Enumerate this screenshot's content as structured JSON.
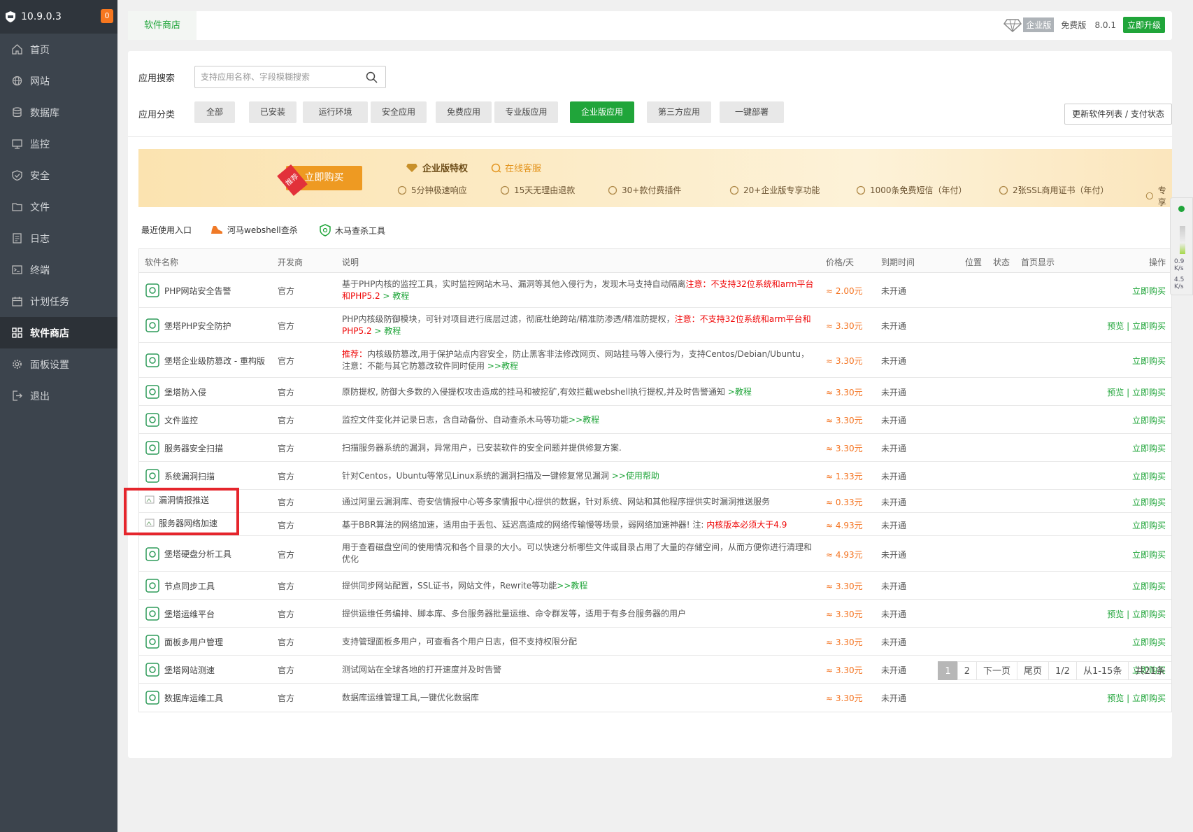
{
  "sidebar": {
    "ip": "10.9.0.3",
    "badge": "0",
    "items": [
      {
        "label": "首页",
        "icon": "home-icon"
      },
      {
        "label": "网站",
        "icon": "globe-icon"
      },
      {
        "label": "数据库",
        "icon": "database-icon"
      },
      {
        "label": "监控",
        "icon": "monitor-icon"
      },
      {
        "label": "安全",
        "icon": "shield-icon"
      },
      {
        "label": "文件",
        "icon": "folder-icon"
      },
      {
        "label": "日志",
        "icon": "log-icon"
      },
      {
        "label": "终端",
        "icon": "terminal-icon"
      },
      {
        "label": "计划任务",
        "icon": "calendar-icon"
      },
      {
        "label": "软件商店",
        "icon": "grid-icon"
      },
      {
        "label": "面板设置",
        "icon": "gear-icon"
      },
      {
        "label": "退出",
        "icon": "logout-icon"
      }
    ],
    "active_index": 9
  },
  "topbar": {
    "tab": "软件商店",
    "edition": "企业版",
    "free": "免费版",
    "version": "8.0.1",
    "upgrade": "立即升级"
  },
  "search": {
    "label": "应用搜索",
    "placeholder": "支持应用名称、字段模糊搜索"
  },
  "category": {
    "label": "应用分类",
    "items": [
      "全部",
      "已安装",
      "运行环境",
      "安全应用",
      "免费应用",
      "专业版应用",
      "企业版应用",
      "第三方应用",
      "一键部署"
    ],
    "active_index": 6,
    "refresh": "更新软件列表 / 支付状态"
  },
  "banner": {
    "badge": "推荐",
    "buy": "立即购买",
    "title": "企业版特权",
    "service": "在线客服",
    "features": [
      "5分钟极速响应",
      "15天无理由退款",
      "30+款付费插件",
      "20+企业版专享功能",
      "1000条免费短信（年付）",
      "2张SSL商用证书（年付）",
      "专享"
    ]
  },
  "recent": {
    "label": "最近使用入口",
    "items": [
      "河马webshell查杀",
      "木马查杀工具"
    ]
  },
  "table": {
    "headers": {
      "name": "软件名称",
      "dev": "开发商",
      "desc": "说明",
      "price": "价格/天",
      "expire": "到期时间",
      "pos": "位置",
      "status": "状态",
      "home": "首页显示",
      "op": "操作"
    },
    "rows": [
      {
        "name": "PHP网站安全告警",
        "dev": "官方",
        "desc": "基于PHP内核的监控工具，实时监控网站木马、漏洞等其他入侵行为，发现木马支持自动隔离",
        "desc_red": "注意：不支持32位系统和arm平台和PHP5.2",
        "desc_link": " > 教程",
        "price": "≈ 2.00元",
        "expire": "未开通",
        "preview": "",
        "buy": "立即购买"
      },
      {
        "name": "堡塔PHP安全防护",
        "dev": "官方",
        "desc": "PHP内核级防御模块，可针对项目进行底层过滤，彻底杜绝跨站/精准防渗透/精准防提权，",
        "desc_red": "注意：不支持32位系统和arm平台和PHP5.2",
        "desc_link": " > 教程",
        "price": "≈ 3.30元",
        "expire": "未开通",
        "preview": "预览 | ",
        "buy": "立即购买"
      },
      {
        "name": "堡塔企业级防篡改 - 重构版",
        "dev": "官方",
        "desc_red": "推荐：",
        "desc": "内核级防篡改,用于保护站点内容安全，防止黑客非法修改网页、网站挂马等入侵行为，支持Centos/Debian/Ubuntu，注意：不能与其它防篡改软件同时使用",
        "desc_link": " >>教程",
        "price": "≈ 3.30元",
        "expire": "未开通",
        "preview": "",
        "buy": "立即购买"
      },
      {
        "name": "堡塔防入侵",
        "dev": "官方",
        "desc": "原防提权, 防御大多数的入侵提权攻击造成的挂马和被挖矿,有效拦截webshell执行提权,并及时告警通知",
        "desc_red": "",
        "desc_link": " >教程",
        "price": "≈ 3.30元",
        "expire": "未开通",
        "preview": "预览 | ",
        "buy": "立即购买"
      },
      {
        "name": "文件监控",
        "dev": "官方",
        "desc": "监控文件变化并记录日志，含自动备份、自动查杀木马等功能",
        "desc_red": "",
        "desc_link": ">>教程",
        "price": "≈ 3.30元",
        "expire": "未开通",
        "preview": "",
        "buy": "立即购买"
      },
      {
        "name": "服务器安全扫描",
        "dev": "官方",
        "desc": "扫描服务器系统的漏洞，异常用户，已安装软件的安全问题并提供修复方案.",
        "desc_red": "",
        "desc_link": "",
        "price": "≈ 3.30元",
        "expire": "未开通",
        "preview": "",
        "buy": "立即购买"
      },
      {
        "name": "系统漏洞扫描",
        "dev": "官方",
        "desc": "针对Centos，Ubuntu等常见Linux系统的漏洞扫描及一键修复常见漏洞 ",
        "desc_red": "",
        "desc_link": ">>使用帮助",
        "price": "≈ 1.33元",
        "expire": "未开通",
        "preview": "",
        "buy": "立即购买"
      },
      {
        "name": "漏洞情报推送",
        "dev": "官方",
        "desc": "通过阿里云漏洞库、奇安信情报中心等多家情报中心提供的数据，针对系统、网站和其他程序提供实时漏洞推送服务",
        "desc_red": "",
        "desc_link": "",
        "price": "≈ 0.33元",
        "expire": "未开通",
        "preview": "",
        "buy": "立即购买"
      },
      {
        "name": "服务器网络加速",
        "dev": "官方",
        "desc": "基于BBR算法的网络加速，适用由于丢包、延迟高造成的网络传输慢等场景，弱网络加速神器! 注: ",
        "desc_red": "内核版本必须大于4.9",
        "desc_link": "",
        "price": "≈ 4.93元",
        "expire": "未开通",
        "preview": "",
        "buy": "立即购买"
      },
      {
        "name": "堡塔硬盘分析工具",
        "dev": "官方",
        "desc": "用于查看磁盘空间的使用情况和各个目录的大小。可以快速分析哪些文件或目录占用了大量的存储空间，从而方便你进行清理和优化",
        "desc_red": "",
        "desc_link": "",
        "price": "≈ 4.93元",
        "expire": "未开通",
        "preview": "",
        "buy": "立即购买"
      },
      {
        "name": "节点同步工具",
        "dev": "官方",
        "desc": "提供同步网站配置，SSL证书，网站文件，Rewrite等功能",
        "desc_red": "",
        "desc_link": ">>教程",
        "price": "≈ 3.30元",
        "expire": "未开通",
        "preview": "",
        "buy": "立即购买"
      },
      {
        "name": "堡塔运维平台",
        "dev": "官方",
        "desc": "提供运维任务编排、脚本库、多台服务器批量运维、命令群发等，适用于有多台服务器的用户",
        "desc_red": "",
        "desc_link": "",
        "price": "≈ 3.30元",
        "expire": "未开通",
        "preview": "预览 | ",
        "buy": "立即购买"
      },
      {
        "name": "面板多用户管理",
        "dev": "官方",
        "desc": "支持管理面板多用户，可查看各个用户日志，但不支持权限分配",
        "desc_red": "",
        "desc_link": "",
        "price": "≈ 3.30元",
        "expire": "未开通",
        "preview": "",
        "buy": "立即购买"
      },
      {
        "name": "堡塔网站测速",
        "dev": "官方",
        "desc": "测试网站在全球各地的打开速度并及时告警",
        "desc_red": "",
        "desc_link": "",
        "price": "≈ 3.30元",
        "expire": "未开通",
        "preview": "",
        "buy": "立即购买"
      },
      {
        "name": "数据库运维工具",
        "dev": "官方",
        "desc": "数据库运维管理工具,一键优化数据库",
        "desc_red": "",
        "desc_link": "",
        "price": "≈ 3.30元",
        "expire": "未开通",
        "preview": "预览 | ",
        "buy": "立即购买"
      }
    ]
  },
  "pager": [
    "1",
    "2",
    "下一页",
    "尾页",
    "1/2",
    "从1-15条",
    "共21条"
  ],
  "float": {
    "up": "0.9 K/s",
    "down": "4.5 K/s"
  }
}
